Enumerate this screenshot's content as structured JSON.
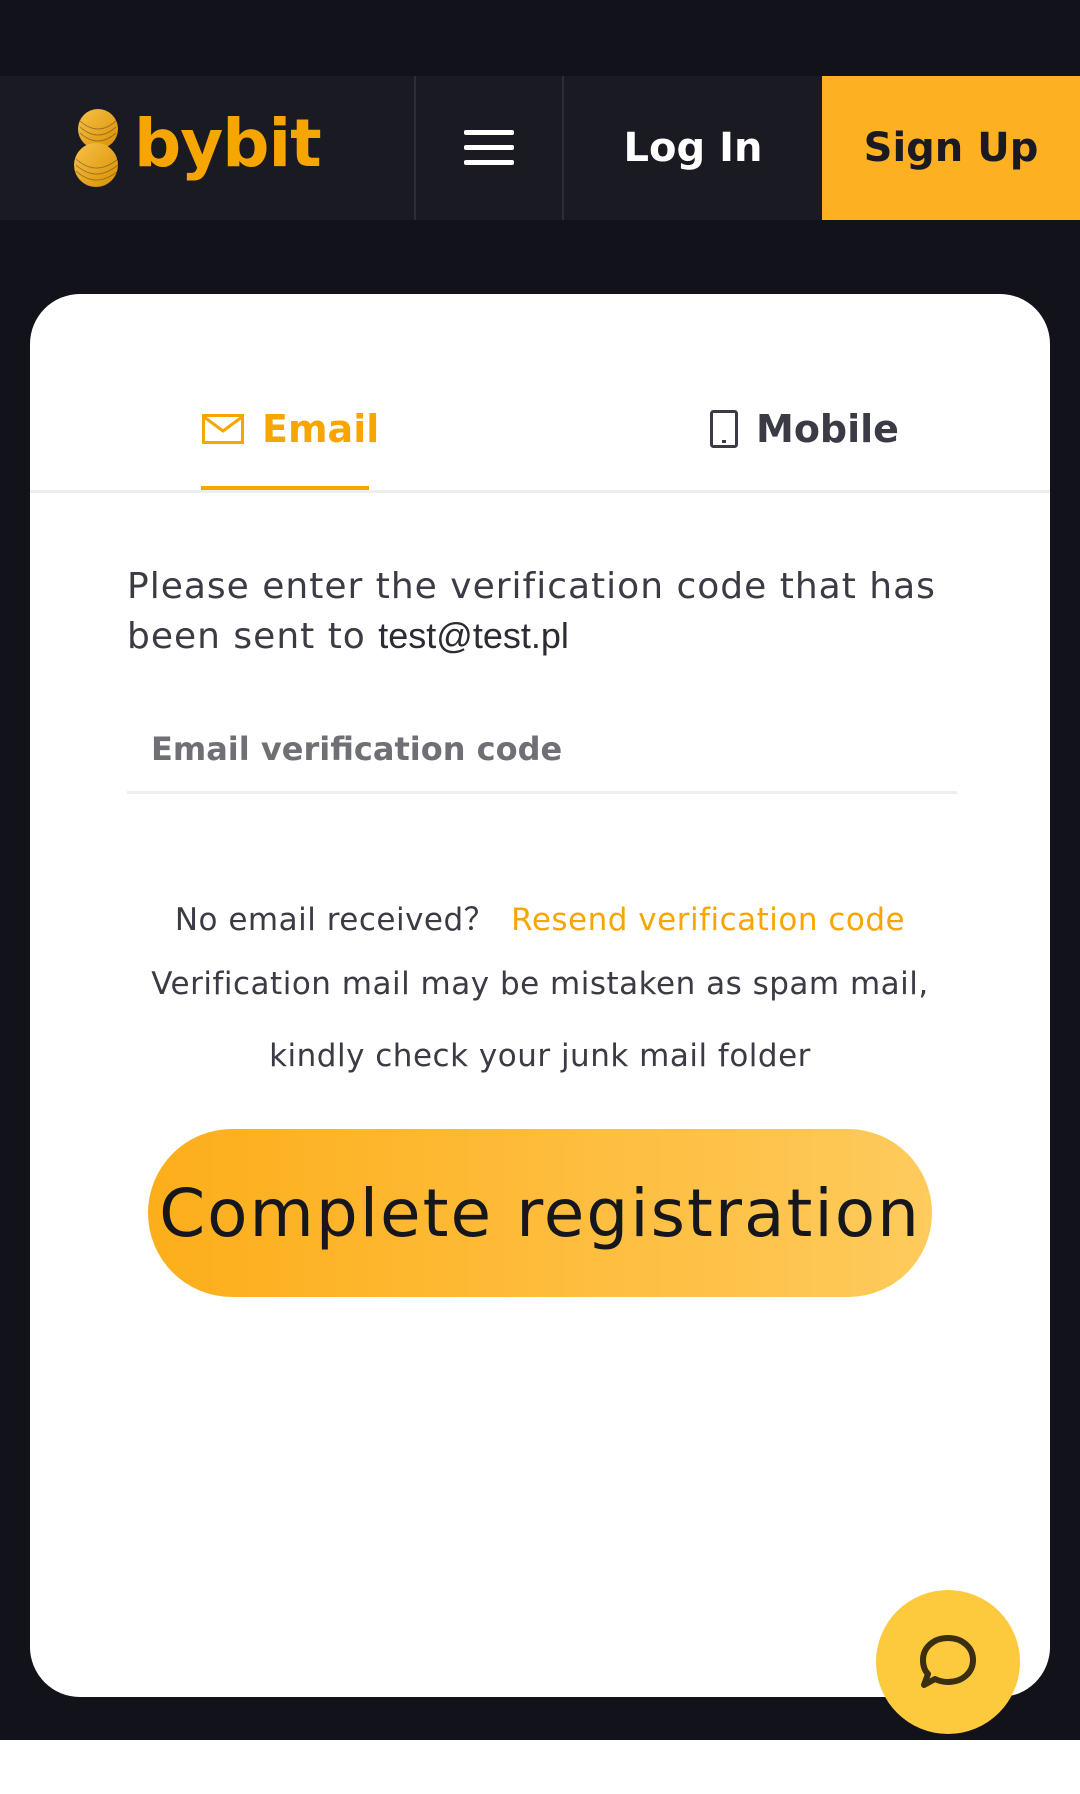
{
  "header": {
    "brand": "bybit",
    "login_label": "Log In",
    "signup_label": "Sign Up",
    "menu_icon": "hamburger-menu-icon"
  },
  "tabs": [
    {
      "label": "Email",
      "icon": "envelope-icon",
      "active": true
    },
    {
      "label": "Mobile",
      "icon": "phone-icon",
      "active": false
    }
  ],
  "form": {
    "instruction_text": "Please enter the verification code that has been sent to ",
    "email": "test@test.pl",
    "code_placeholder": "Email verification code",
    "code_value": "",
    "no_email_text": "No email received？",
    "resend_label": "Resend verification code",
    "spam_note_line1": "Verification mail may be mistaken as spam mail,",
    "spam_note_line2": "kindly check your junk mail folder",
    "submit_label": "Complete registration"
  },
  "chat": {
    "icon": "chat-bubble-icon"
  },
  "colors": {
    "accent": "#f7a600",
    "signup_bg": "#fdb022",
    "header_bg": "#1a1b22",
    "page_bg": "#12131a"
  }
}
